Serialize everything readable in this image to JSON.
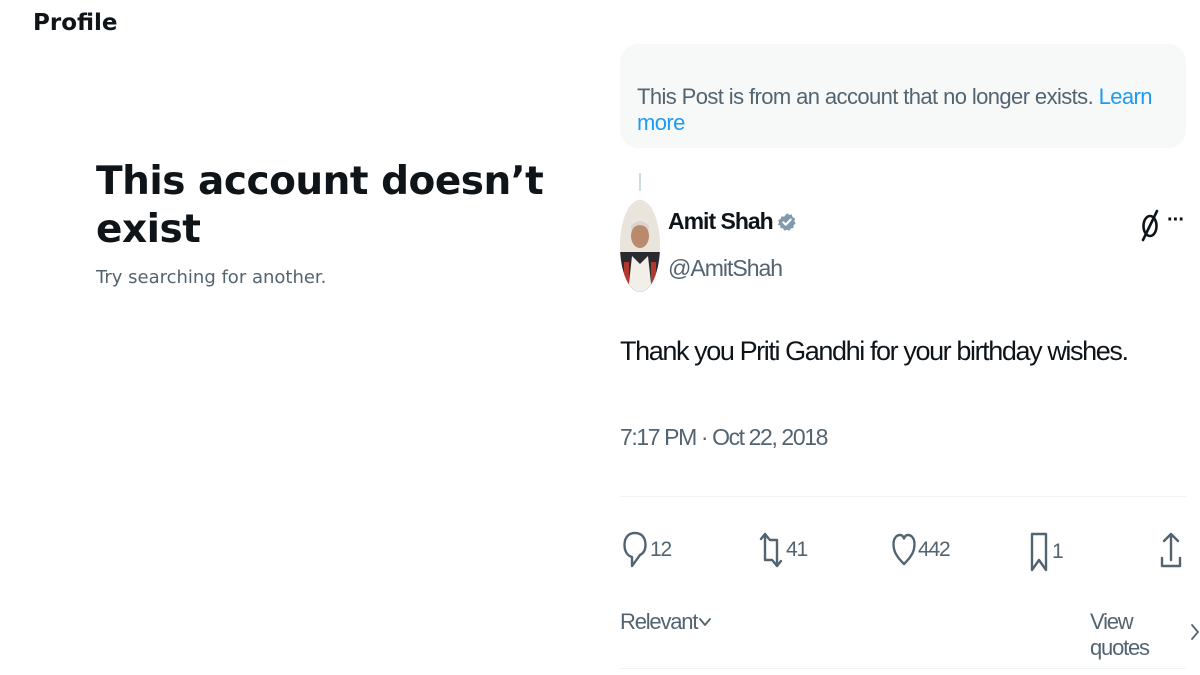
{
  "left_panel": {
    "title": "Profile",
    "heading": "This account doesn’t exist",
    "subtext": "Try searching for another."
  },
  "notice": {
    "text": "This Post is from an account that no longer exists. ",
    "link": "Learn more"
  },
  "post": {
    "author_name": "Amit Shah",
    "handle": "@AmitShah",
    "verified_icon": "verified-badge-icon",
    "text": "Thank you Priti Gandhi for your birthday wishes.",
    "timestamp": "7:17 PM · Oct 22, 2018",
    "more_label": "···",
    "actions": {
      "replies": "12",
      "reposts": "41",
      "likes": "442",
      "bookmarks": "1"
    },
    "sort_label": "Relevant",
    "view_quotes_label": "View quotes"
  },
  "colors": {
    "accent": "#1d9bf0",
    "text_primary": "#0f1419",
    "text_secondary": "#536471",
    "notice_bg": "#f7f9f9",
    "verified": "#829aab"
  }
}
